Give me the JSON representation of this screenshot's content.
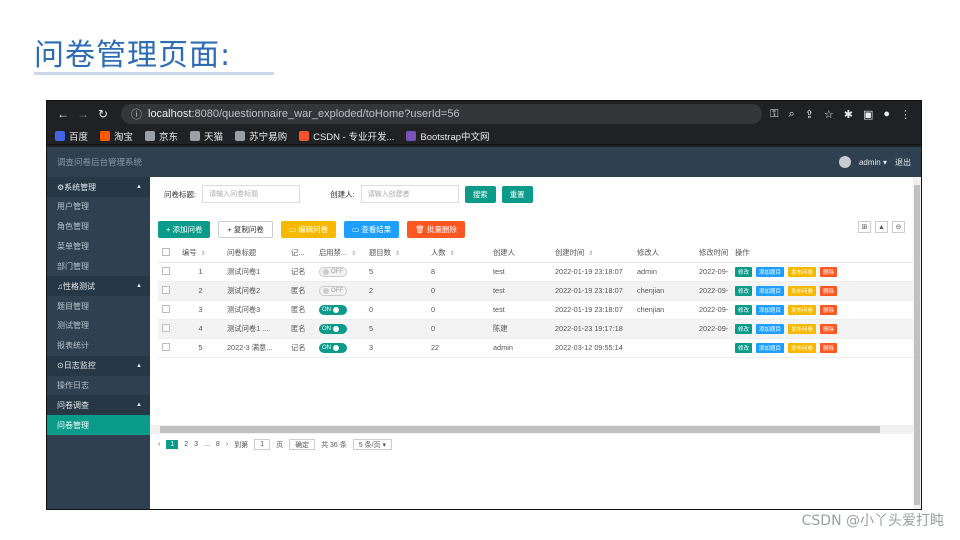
{
  "slide": {
    "title": "问卷管理页面:",
    "watermark": "CSDN @小丫头爱打盹"
  },
  "browser": {
    "url_host": "localhost",
    "url_rest": ":8080/questionnaire_war_exploded/toHome?userId=56",
    "bookmarks": [
      {
        "label": "百度",
        "color": "#3f66e8"
      },
      {
        "label": "淘宝",
        "color": "#ff5a00"
      },
      {
        "label": "京东",
        "color": "#9aa0a6"
      },
      {
        "label": "天猫",
        "color": "#9aa0a6"
      },
      {
        "label": "苏宁易购",
        "color": "#9aa0a6"
      },
      {
        "label": "CSDN - 专业开发...",
        "color": "#fc5531"
      },
      {
        "label": "Bootstrap中文网",
        "color": "#7952b3"
      }
    ]
  },
  "app": {
    "system_title": "调查问卷后台管理系统",
    "user": "admin",
    "logout": "退出",
    "sidebar": {
      "groups": [
        {
          "label": "⚙系统管理",
          "items": [
            "用户管理",
            "角色管理",
            "菜单管理",
            "部门管理"
          ]
        },
        {
          "label": "♫性格测试",
          "items": [
            "题目管理",
            "测试管理",
            "报表统计"
          ]
        },
        {
          "label": "⊙日志监控",
          "items": [
            "操作日志"
          ]
        },
        {
          "label": "问卷调查",
          "items": [
            "问卷管理"
          ]
        }
      ],
      "active": "问卷管理"
    },
    "search": {
      "title_label": "问卷标题:",
      "title_placeholder": "请输入问卷标题",
      "creator_label": "创建人:",
      "creator_placeholder": "请输入创建者",
      "search_btn": "搜索",
      "reset_btn": "重置"
    },
    "toolbar": [
      {
        "label": "+ 添加问卷",
        "color": "#0b9b8a",
        "text": "#ffffff"
      },
      {
        "label": "+ 复制问卷",
        "color": "#ffffff",
        "text": "#333333"
      },
      {
        "label": "▭ 编辑问卷",
        "color": "#f7b900",
        "text": "#ffffff"
      },
      {
        "label": "▭ 查看结果",
        "color": "#1e9fff",
        "text": "#ffffff"
      },
      {
        "label": "🗑 批量删除",
        "color": "#ff5722",
        "text": "#ffffff"
      }
    ],
    "tool_icons": [
      "⊞",
      "▲",
      "⊖"
    ],
    "columns": [
      "",
      "编号",
      "问卷标题",
      "记...",
      "启用禁...",
      "题目数",
      "人数",
      "创建人",
      "创建时间",
      "修改人",
      "修改时间",
      "操作"
    ],
    "rows": [
      {
        "id": "1",
        "title": "测试问卷1",
        "type": "记名",
        "enabled": "OFF",
        "questions": "5",
        "people": "8",
        "creator": "test",
        "created": "2022-01-19 23:18:07",
        "modifier": "admin",
        "modified": "2022-09-"
      },
      {
        "id": "2",
        "title": "测试问卷2",
        "type": "匿名",
        "enabled": "OFF",
        "questions": "2",
        "people": "0",
        "creator": "test",
        "created": "2022-01-19 23:18:07",
        "modifier": "chenjian",
        "modified": "2022-09-"
      },
      {
        "id": "3",
        "title": "测试问卷3",
        "type": "匿名",
        "enabled": "ON",
        "questions": "0",
        "people": "0",
        "creator": "test",
        "created": "2022-01-19 23:18:07",
        "modifier": "chenjian",
        "modified": "2022-09-"
      },
      {
        "id": "4",
        "title": "测试问卷1 ...",
        "type": "匿名",
        "enabled": "ON",
        "questions": "5",
        "people": "0",
        "creator": "陈建",
        "created": "2022-01-23 19:17:18",
        "modifier": "",
        "modified": "2022-09-"
      },
      {
        "id": "5",
        "title": "2022-3 满意...",
        "type": "记名",
        "enabled": "ON",
        "questions": "3",
        "people": "22",
        "creator": "admin",
        "created": "2022-03-12 09:55:14",
        "modifier": "",
        "modified": ""
      }
    ],
    "ops": [
      {
        "label": "修改",
        "color": "#0b9b8a"
      },
      {
        "label": "添加题目",
        "color": "#1e9fff"
      },
      {
        "label": "发布问卷",
        "color": "#f7b900"
      },
      {
        "label": "删除",
        "color": "#ff5722"
      }
    ],
    "pager": {
      "pages": [
        "1",
        "2",
        "3",
        "...",
        "8"
      ],
      "goto": "到第",
      "page_input": "1",
      "page_unit": "页",
      "confirm": "确定",
      "total": "共 36 条",
      "size": "5 条/页"
    }
  }
}
